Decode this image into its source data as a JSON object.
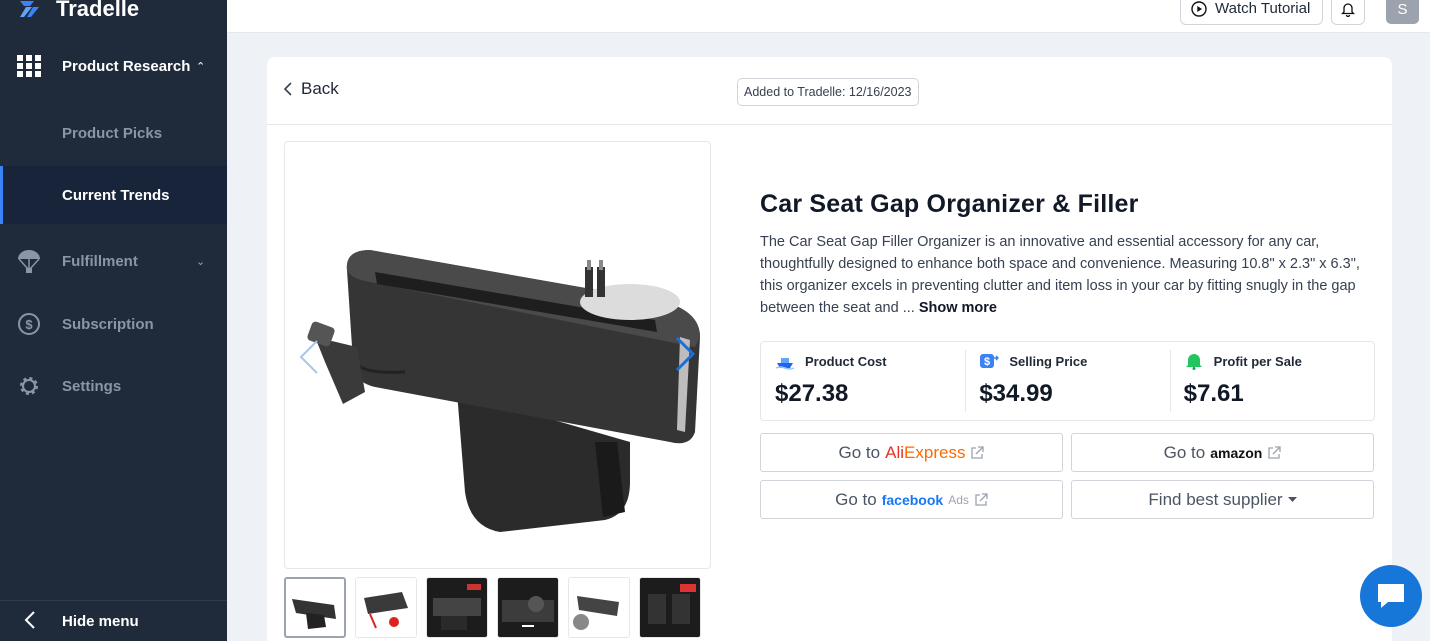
{
  "brand": {
    "name": "Tradelle"
  },
  "sidebar": {
    "items": [
      {
        "label": "Product Research",
        "icon": "grid-icon"
      },
      {
        "label": "Product Picks"
      },
      {
        "label": "Current Trends"
      },
      {
        "label": "Fulfillment",
        "icon": "parachute-icon"
      },
      {
        "label": "Subscription",
        "icon": "dollar-icon"
      },
      {
        "label": "Settings",
        "icon": "gear-icon"
      }
    ],
    "hide_menu": "Hide menu"
  },
  "topbar": {
    "watch_tutorial": "Watch Tutorial",
    "avatar_initial": "S"
  },
  "detail": {
    "back_label": "Back",
    "added_badge": "Added to Tradelle: 12/16/2023",
    "title": "Car Seat Gap Organizer & Filler",
    "description": "The Car Seat Gap Filler Organizer is an innovative and essential accessory for any car, thoughtfully designed to enhance both space and convenience. Measuring 10.8\" x 2.3\" x 6.3\", this organizer excels in preventing clutter and item loss in your car by fitting snugly in the gap between the seat and ...",
    "show_more": "Show more",
    "metrics": [
      {
        "label": "Product Cost",
        "value": "$27.38",
        "icon": "ship-icon"
      },
      {
        "label": "Selling Price",
        "value": "$34.99",
        "icon": "price-tag-icon"
      },
      {
        "label": "Profit per Sale",
        "value": "$7.61",
        "icon": "bell-money-icon"
      }
    ],
    "links": {
      "go_to": "Go to",
      "aliexpress_a": "Ali",
      "aliexpress_b": "Express",
      "amazon": "amazon",
      "facebook": "facebook",
      "facebook_ads": "Ads",
      "find_supplier": "Find best supplier"
    }
  },
  "colors": {
    "sidebar_bg": "#1f2a3b",
    "active_accent": "#3b82f6",
    "aliexpress": "#ff6a00",
    "facebook": "#1877f2",
    "chat_bubble": "#1677d8"
  }
}
